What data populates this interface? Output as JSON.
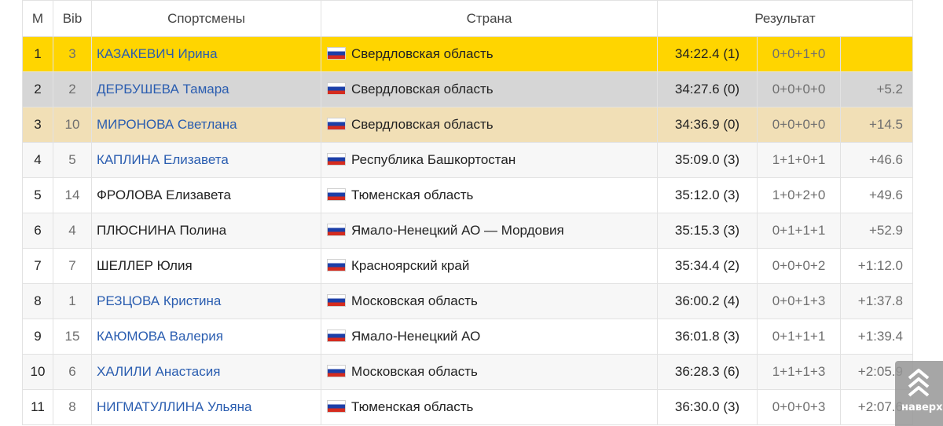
{
  "table": {
    "headers": {
      "place": "М",
      "bib": "Bib",
      "athletes": "Спортсмены",
      "country": "Страна",
      "result": "Результат"
    },
    "rows": [
      {
        "place": "1",
        "bib": "3",
        "name": "КАЗАКЕВИЧ Ирина",
        "linked": true,
        "flag": "ru-flag",
        "region": "Свердловская область",
        "time": "34:22.4 (1)",
        "penalties": "0+0+1+0",
        "gap": ""
      },
      {
        "place": "2",
        "bib": "2",
        "name": "ДЕРБУШЕВА Тамара",
        "linked": true,
        "flag": "ru-flag",
        "region": "Свердловская область",
        "time": "34:27.6 (0)",
        "penalties": "0+0+0+0",
        "gap": "+5.2"
      },
      {
        "place": "3",
        "bib": "10",
        "name": "МИРОНОВА Светлана",
        "linked": true,
        "flag": "ru-flag",
        "region": "Свердловская область",
        "time": "34:36.9 (0)",
        "penalties": "0+0+0+0",
        "gap": "+14.5"
      },
      {
        "place": "4",
        "bib": "5",
        "name": "КАПЛИНА Елизавета",
        "linked": true,
        "flag": "ru-flag",
        "region": "Республика Башкортостан",
        "time": "35:09.0 (3)",
        "penalties": "1+1+0+1",
        "gap": "+46.6"
      },
      {
        "place": "5",
        "bib": "14",
        "name": "ФРОЛОВА Елизавета",
        "linked": false,
        "flag": "ru-flag",
        "region": "Тюменская область",
        "time": "35:12.0 (3)",
        "penalties": "1+0+2+0",
        "gap": "+49.6"
      },
      {
        "place": "6",
        "bib": "4",
        "name": "ПЛЮСНИНА Полина",
        "linked": false,
        "flag": "ru-flag",
        "region": "Ямало-Ненецкий АО — Мордовия",
        "time": "35:15.3 (3)",
        "penalties": "0+1+1+1",
        "gap": "+52.9"
      },
      {
        "place": "7",
        "bib": "7",
        "name": "ШЕЛЛЕР Юлия",
        "linked": false,
        "flag": "ru-flag",
        "region": "Красноярский край",
        "time": "35:34.4 (2)",
        "penalties": "0+0+0+2",
        "gap": "+1:12.0"
      },
      {
        "place": "8",
        "bib": "1",
        "name": "РЕЗЦОВА Кристина",
        "linked": true,
        "flag": "ru-flag",
        "region": "Московская область",
        "time": "36:00.2 (4)",
        "penalties": "0+0+1+3",
        "gap": "+1:37.8"
      },
      {
        "place": "9",
        "bib": "15",
        "name": "КАЮМОВА Валерия",
        "linked": true,
        "flag": "ru-flag",
        "region": "Ямало-Ненецкий АО",
        "time": "36:01.8 (3)",
        "penalties": "0+1+1+1",
        "gap": "+1:39.4"
      },
      {
        "place": "10",
        "bib": "6",
        "name": "ХАЛИЛИ Анастасия",
        "linked": true,
        "flag": "ru-flag",
        "region": "Московская область",
        "time": "36:28.3 (6)",
        "penalties": "1+1+1+3",
        "gap": "+2:05.9"
      },
      {
        "place": "11",
        "bib": "8",
        "name": "НИГМАТУЛЛИНА Ульяна",
        "linked": true,
        "flag": "ru-flag",
        "region": "Тюменская область",
        "time": "36:30.0 (3)",
        "penalties": "0+0+0+3",
        "gap": "+2:07.6"
      }
    ]
  },
  "scroll_top": {
    "label": "наверх",
    "icon": "chevrons-up-icon"
  },
  "colors": {
    "gold": "#ffd500",
    "silver": "#d6d6d6",
    "bronze": "#f1dfb6",
    "link": "#2a5db0"
  }
}
